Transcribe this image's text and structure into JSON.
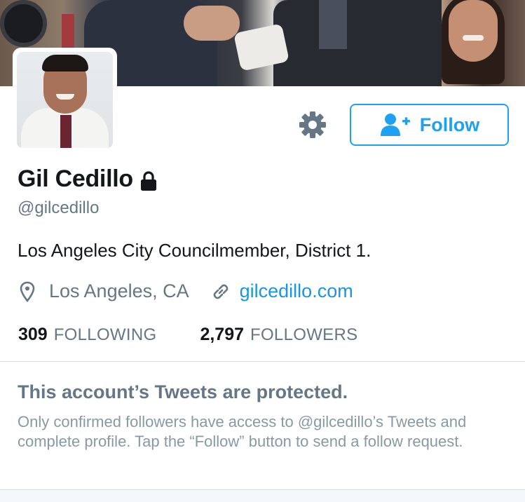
{
  "profile": {
    "name": "Gil Cedillo",
    "handle": "@gilcedillo",
    "bio": "Los Angeles City Councilmember, District 1.",
    "location": "Los Angeles, CA",
    "url": "gilcedillo.com"
  },
  "actions": {
    "follow_label": "Follow"
  },
  "stats": {
    "following_count": "309",
    "following_label": "FOLLOWING",
    "followers_count": "2,797",
    "followers_label": "FOLLOWERS"
  },
  "protected": {
    "title": "This account’s Tweets are protected.",
    "body": "Only confirmed followers have access to @gilcedillo’s Tweets and complete profile. Tap the “Follow” button to send a follow request."
  },
  "icons": {
    "settings": "gear-icon",
    "follow": "add-user-icon",
    "lock": "lock-icon",
    "location": "map-pin-icon",
    "link": "link-icon"
  },
  "colors": {
    "accent": "#1da1f2",
    "link": "#1b95e0",
    "muted": "#657786",
    "text": "#14171a"
  }
}
